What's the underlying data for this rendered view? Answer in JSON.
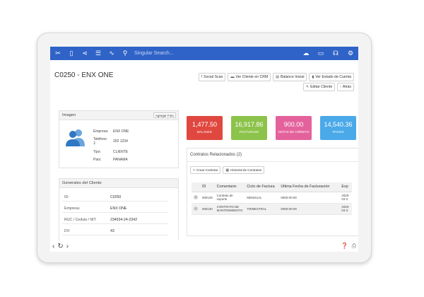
{
  "topbar": {
    "search_placeholder": "Singular Search...",
    "left_icons": [
      "scissors-icon",
      "building-icon",
      "share-icon",
      "list-icon",
      "chart-icon",
      "search-icon"
    ],
    "right_icons": [
      "cloud-icon",
      "card-icon",
      "headset-icon",
      "gear-icon"
    ],
    "color": "#2f63c7"
  },
  "page": {
    "title": "C0250 - ENX ONE"
  },
  "actions": {
    "row1": [
      {
        "label": "Social Scan",
        "icon": "f"
      },
      {
        "label": "Ver Cliente en CRM",
        "icon": "▬"
      },
      {
        "label": "Balance Inicial",
        "icon": "▤"
      },
      {
        "label": "Ver Estado de Cuenta",
        "icon": "▮"
      }
    ],
    "row2": [
      {
        "label": "Editar Cliente",
        "icon": "✎"
      },
      {
        "label": "Atrás",
        "icon": "‹"
      }
    ]
  },
  "image_panel": {
    "title": "Imagen",
    "upload_label": "Agregar Foto",
    "fields": [
      {
        "k": "Empresa:",
        "v": "ENX ONE"
      },
      {
        "k": "Teléfono 1:",
        "v": "202 1234"
      },
      {
        "k": "Tipo:",
        "v": "CLIENTE"
      },
      {
        "k": "País:",
        "v": "PANAMA"
      }
    ]
  },
  "stats": [
    {
      "value": "1,477.50",
      "label": "BALANCE",
      "color": "#e0483f"
    },
    {
      "value": "16,917.86",
      "label": "FACTURADO",
      "color": "#8cc34b"
    },
    {
      "value": "900.00",
      "label": "NOTAS DE CRÉDITO",
      "color": "#e4629c"
    },
    {
      "value": "14,540.36",
      "label": "PAGOS",
      "color": "#4aa9e9"
    }
  ],
  "generales": {
    "title": "Generales del Cliente",
    "rows": [
      {
        "k": "ID:",
        "v": "C0250"
      },
      {
        "k": "Empresa:",
        "v": "ENX ONE"
      },
      {
        "k": "RUC / Cedula / NIT:",
        "v": "234534-24-2342"
      },
      {
        "k": "DV:",
        "v": "43"
      }
    ]
  },
  "contratos": {
    "title": "Contratos Relacionados (2)",
    "btn_crear": "Crear Contrato",
    "btn_historial": "Historial de Contratos",
    "headers": [
      "",
      "ID",
      "Comentario",
      "Ciclo de Factura",
      "Ultima Fecha de Facturación",
      "Exp"
    ],
    "rows": [
      {
        "id": "000129",
        "comentario": "Contrato de soporte",
        "ciclo": "MENSUAL",
        "fecha": "0000-00-00",
        "exp": "2020-04-2"
      },
      {
        "id": "000130",
        "comentario": "CONTRATO DE MANTENIMIENTO",
        "ciclo": "TRIMESTRAL",
        "fecha": "0000-00-00",
        "exp": "2020-04-3"
      }
    ]
  }
}
